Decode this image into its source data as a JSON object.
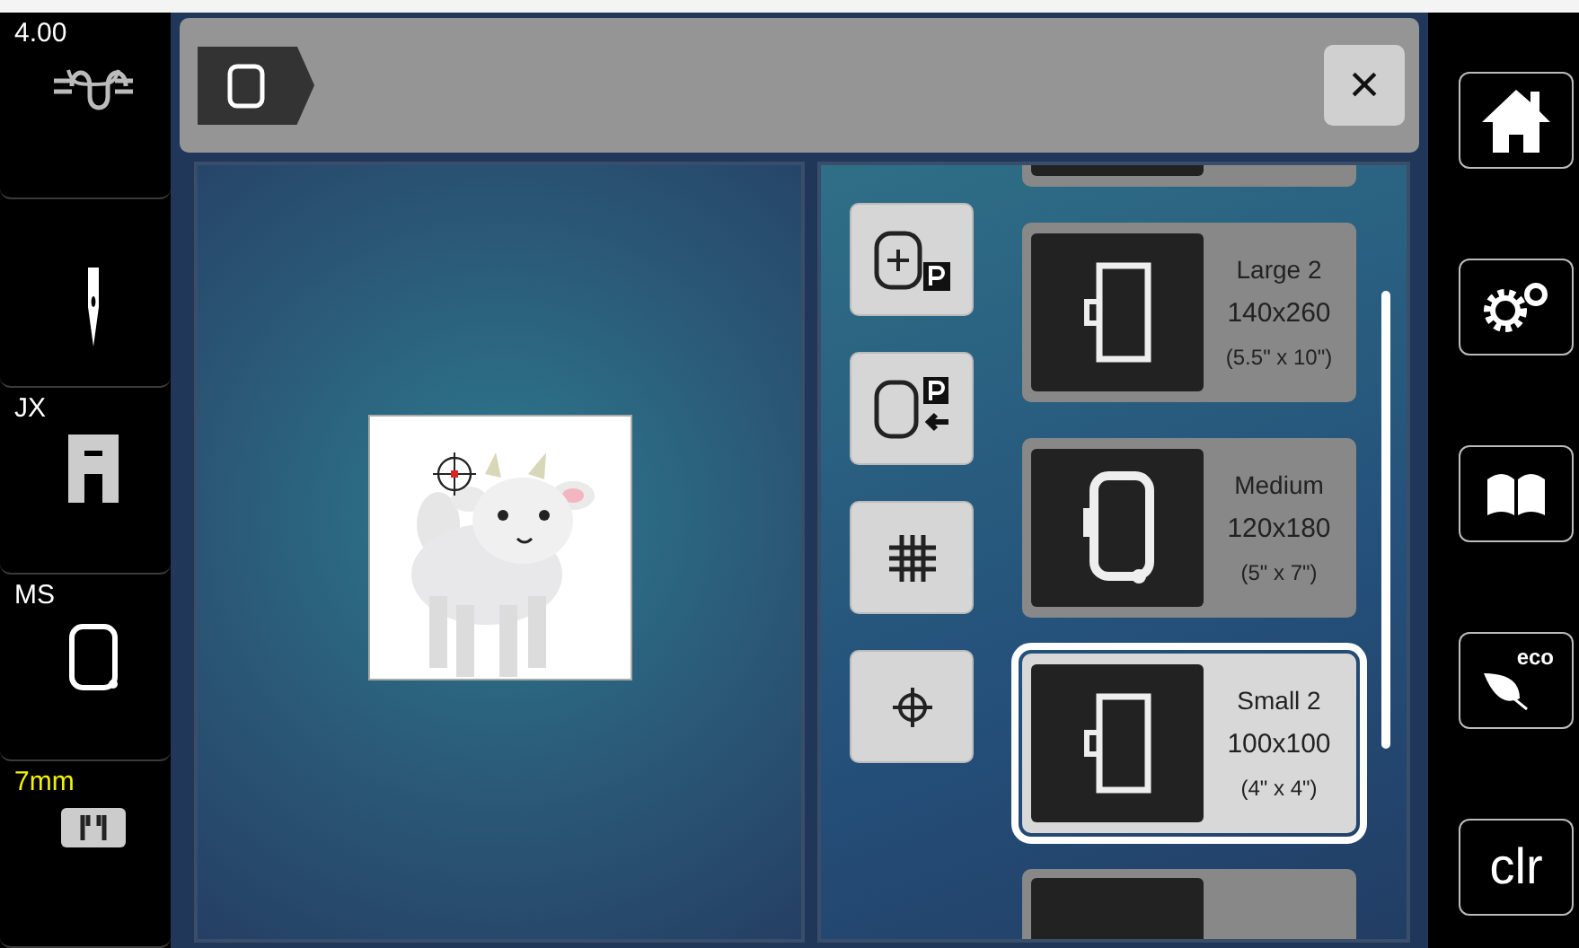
{
  "status_sidebar": [
    {
      "kind": "tension",
      "label": "4.00",
      "color": "#ffffff"
    },
    {
      "kind": "needle"
    },
    {
      "kind": "foot",
      "label": "JX",
      "color": "#ffffff"
    },
    {
      "kind": "hoop",
      "label": "MS",
      "color": "#ffffff"
    },
    {
      "kind": "plate",
      "label": "7mm",
      "color": "#f2f200"
    }
  ],
  "header": {
    "close_symbol": "×"
  },
  "tools": [
    {
      "kind": "center-p"
    },
    {
      "kind": "hoop-p"
    },
    {
      "kind": "grid"
    },
    {
      "kind": "crosshair"
    }
  ],
  "hoops": [
    {
      "kind": "rect",
      "cut_top": true,
      "selected": false
    },
    {
      "kind": "rect",
      "name": "Large 2",
      "size": "140x260",
      "inches": "(5.5\" x 10\")",
      "selected": false
    },
    {
      "kind": "oval",
      "name": "Medium",
      "size": "120x180",
      "inches": "(5\" x 7\")",
      "selected": false
    },
    {
      "kind": "rect",
      "name": "Small 2",
      "size": "100x100",
      "inches": "(4\" x 4\")",
      "selected": true
    },
    {
      "kind": "rect",
      "cut_bottom": true,
      "selected": false
    }
  ],
  "action_sidebar": [
    {
      "kind": "home"
    },
    {
      "kind": "settings"
    },
    {
      "kind": "book"
    },
    {
      "kind": "eco",
      "label": "eco"
    },
    {
      "kind": "clear",
      "label": "clr"
    }
  ]
}
